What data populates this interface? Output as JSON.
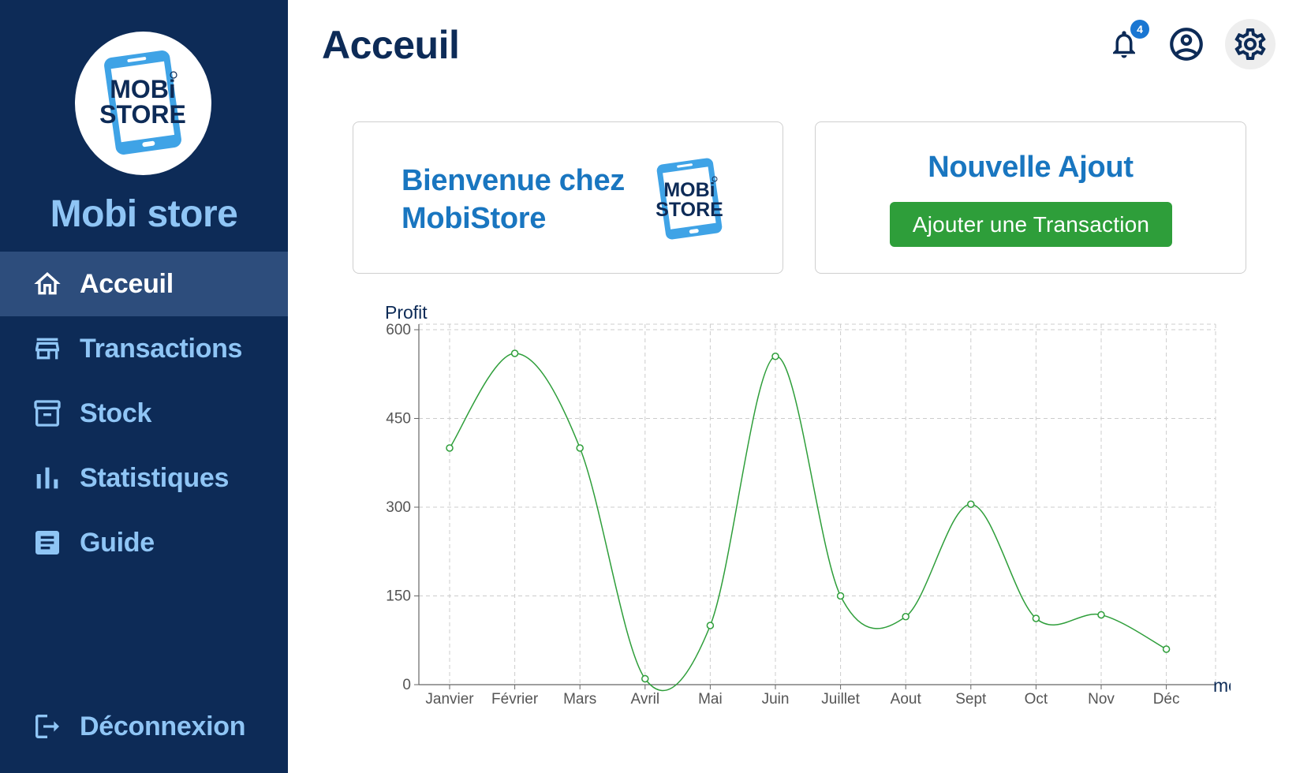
{
  "sidebar": {
    "logo_text": [
      "MOBi",
      "STORE"
    ],
    "brand_name": "Mobi store",
    "items": [
      {
        "label": "Acceuil",
        "icon": "home-icon",
        "active": true
      },
      {
        "label": "Transactions",
        "icon": "store-icon",
        "active": false
      },
      {
        "label": "Stock",
        "icon": "archive-icon",
        "active": false
      },
      {
        "label": "Statistiques",
        "icon": "bar-chart-icon",
        "active": false
      },
      {
        "label": "Guide",
        "icon": "article-icon",
        "active": false
      }
    ],
    "logout_label": "Déconnexion",
    "logout_icon": "logout-icon"
  },
  "header": {
    "title": "Acceuil",
    "notification_count": "4",
    "icons": [
      "bell-icon",
      "account-circle-icon",
      "gear-icon"
    ]
  },
  "welcome_card": {
    "text": "Bienvenue chez MobiStore"
  },
  "add_card": {
    "title": "Nouvelle Ajout",
    "button_label": "Ajouter une Transaction"
  },
  "colors": {
    "sidebar_bg": "#0d2b57",
    "sidebar_active": "#2d4d7c",
    "sidebar_text": "#8fc5f5",
    "accent_blue": "#1976c0",
    "button_green": "#2e9e3a",
    "line_green": "#2e9e3a",
    "logo_blue": "#3fa3e6"
  },
  "chart_data": {
    "type": "line",
    "title": "",
    "ylabel": "Profit",
    "xlabel": "mois",
    "categories": [
      "Janvier",
      "Février",
      "Mars",
      "Avril",
      "Mai",
      "Juin",
      "Juillet",
      "Aout",
      "Sept",
      "Oct",
      "Nov",
      "Déc"
    ],
    "series": [
      {
        "values": [
          400,
          560,
          400,
          10,
          100,
          555,
          150,
          115,
          305,
          112,
          118,
          60
        ]
      }
    ],
    "ylim": [
      0,
      600
    ],
    "yticks": [
      0,
      150,
      300,
      450,
      600
    ],
    "grid": true,
    "curve": "smooth"
  }
}
